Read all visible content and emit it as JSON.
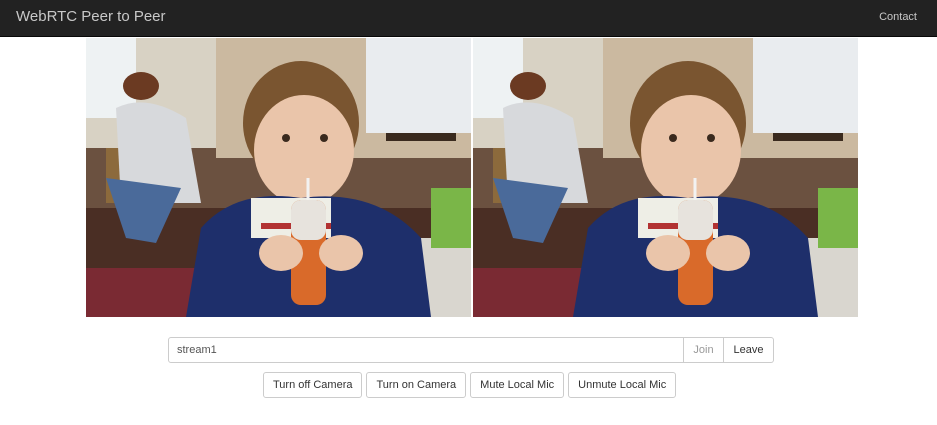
{
  "navbar": {
    "brand": "WebRTC Peer to Peer",
    "contact": "Contact"
  },
  "videos": {
    "local": {
      "icon": "video-frame-child-drinking"
    },
    "remote": {
      "icon": "video-frame-child-drinking"
    }
  },
  "stream": {
    "value": "stream1",
    "join_label": "Join",
    "leave_label": "Leave"
  },
  "media_controls": {
    "camera_off": "Turn off Camera",
    "camera_on": "Turn on Camera",
    "mute": "Mute Local Mic",
    "unmute": "Unmute Local Mic"
  },
  "colors": {
    "navbar_bg": "#222222",
    "navbar_text": "#c8c8c8",
    "border": "#cccccc"
  }
}
